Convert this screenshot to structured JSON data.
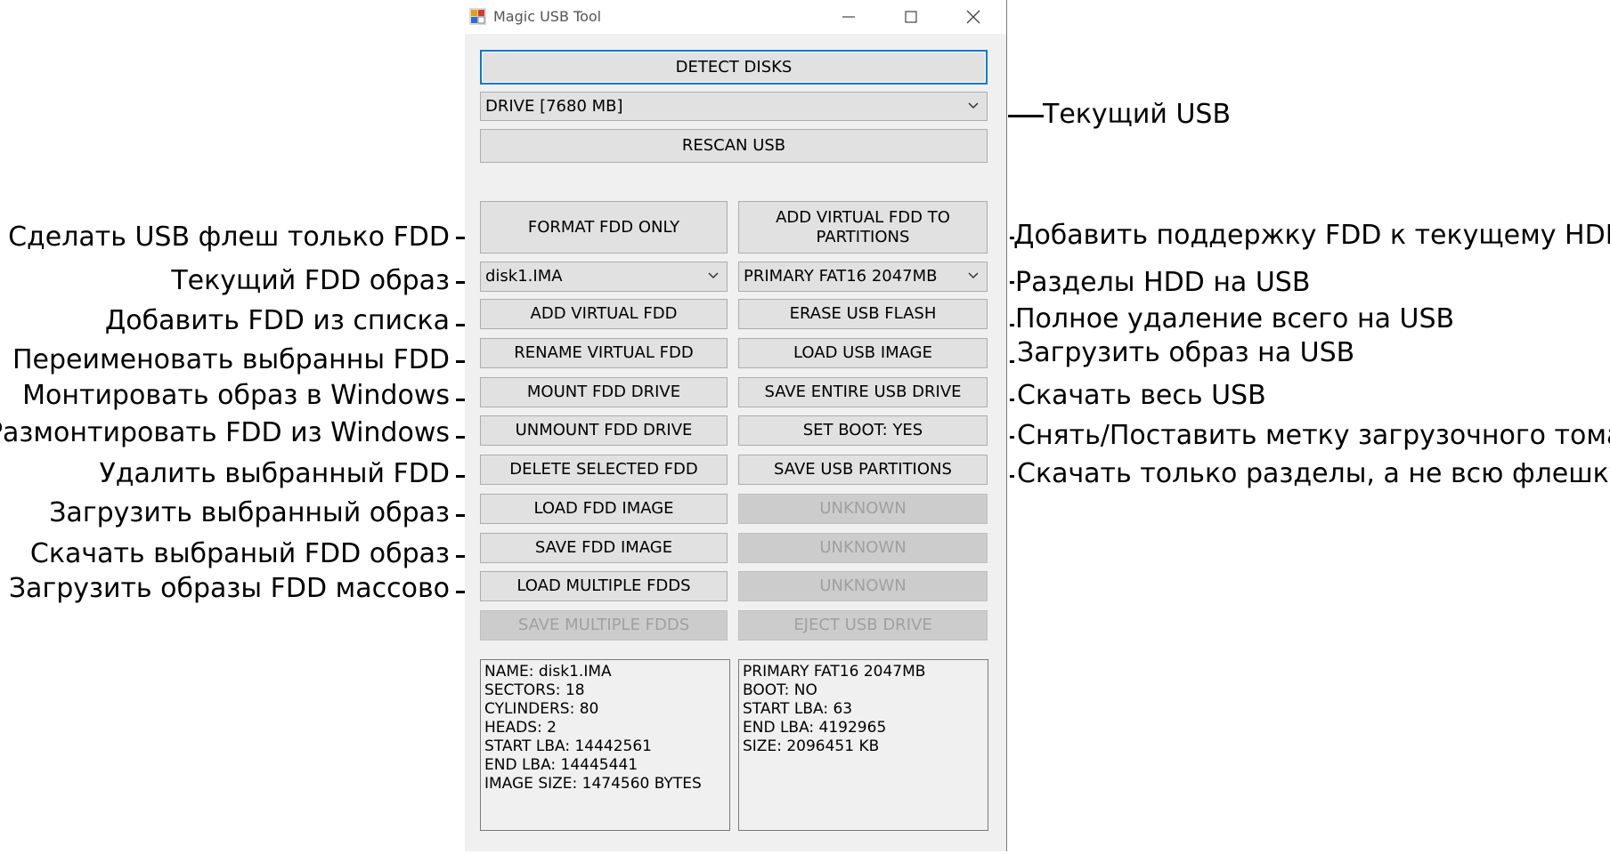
{
  "window": {
    "title": "Magic USB Tool",
    "colors": {
      "focus": "#0078d7",
      "button": "#e1e1e1",
      "disabled": "#cccccc"
    }
  },
  "top": {
    "detect_label": "DETECT DISKS",
    "drive_selected": "DRIVE [7680 MB]",
    "rescan_label": "RESCAN USB"
  },
  "fdd": {
    "format_label": "FORMAT FDD ONLY",
    "image_selected": "disk1.IMA",
    "add_label": "ADD VIRTUAL FDD",
    "rename_label": "RENAME VIRTUAL FDD",
    "mount_label": "MOUNT FDD DRIVE",
    "unmount_label": "UNMOUNT FDD DRIVE",
    "delete_label": "DELETE SELECTED FDD",
    "load_label": "LOAD FDD IMAGE",
    "save_label": "SAVE FDD IMAGE",
    "load_multi_label": "LOAD MULTIPLE FDDS",
    "save_multi_label": "SAVE MULTIPLE FDDS"
  },
  "usb": {
    "add_fdd_to_partitions_label": "ADD VIRTUAL FDD TO PARTITIONS",
    "partition_selected": "PRIMARY FAT16 2047MB",
    "erase_label": "ERASE USB FLASH",
    "load_image_label": "LOAD USB IMAGE",
    "save_entire_label": "SAVE ENTIRE USB DRIVE",
    "set_boot_label": "SET BOOT: YES",
    "save_partitions_label": "SAVE USB PARTITIONS",
    "unknown1_label": "UNKNOWN",
    "unknown2_label": "UNKNOWN",
    "unknown3_label": "UNKNOWN",
    "eject_label": "EJECT USB DRIVE"
  },
  "fdd_info": [
    "NAME: disk1.IMA",
    "SECTORS: 18",
    "CYLINDERS: 80",
    "HEADS: 2",
    "START LBA: 14442561",
    "END LBA: 14445441",
    "IMAGE SIZE: 1474560 BYTES"
  ],
  "partition_info": [
    "PRIMARY FAT16 2047MB",
    "BOOT: NO",
    "START LBA: 63",
    "END LBA: 4192965",
    "SIZE: 2096451 KB"
  ],
  "annotations": {
    "current_usb": "Текущий USB",
    "left": {
      "format": "Сделать USB флеш только FDD",
      "current_image": "Текущий FDD образ",
      "add": "Добавить FDD из списка",
      "rename": "Переименовать выбранны FDD",
      "mount": "Монтировать образ в Windows",
      "unmount": "Размонтировать FDD из Windows",
      "delete": "Удалить выбранный FDD",
      "load": "Загрузить выбранный образ",
      "save": "Скачать выбраный FDD образ",
      "load_multi": "Загрузить образы FDD массово"
    },
    "right": {
      "add_fdd": "Добавить поддержку FDD к текущему HDD",
      "partitions": "Разделы HDD на USB",
      "erase": "Полное удаление всего на USB",
      "load_image": "Загрузить образ на USB",
      "save_entire": "Скачать весь USB",
      "set_boot": "Снять/Поставить метку загрузочного тома",
      "save_partitions": "Скачать только разделы, а не всю флешку"
    }
  }
}
